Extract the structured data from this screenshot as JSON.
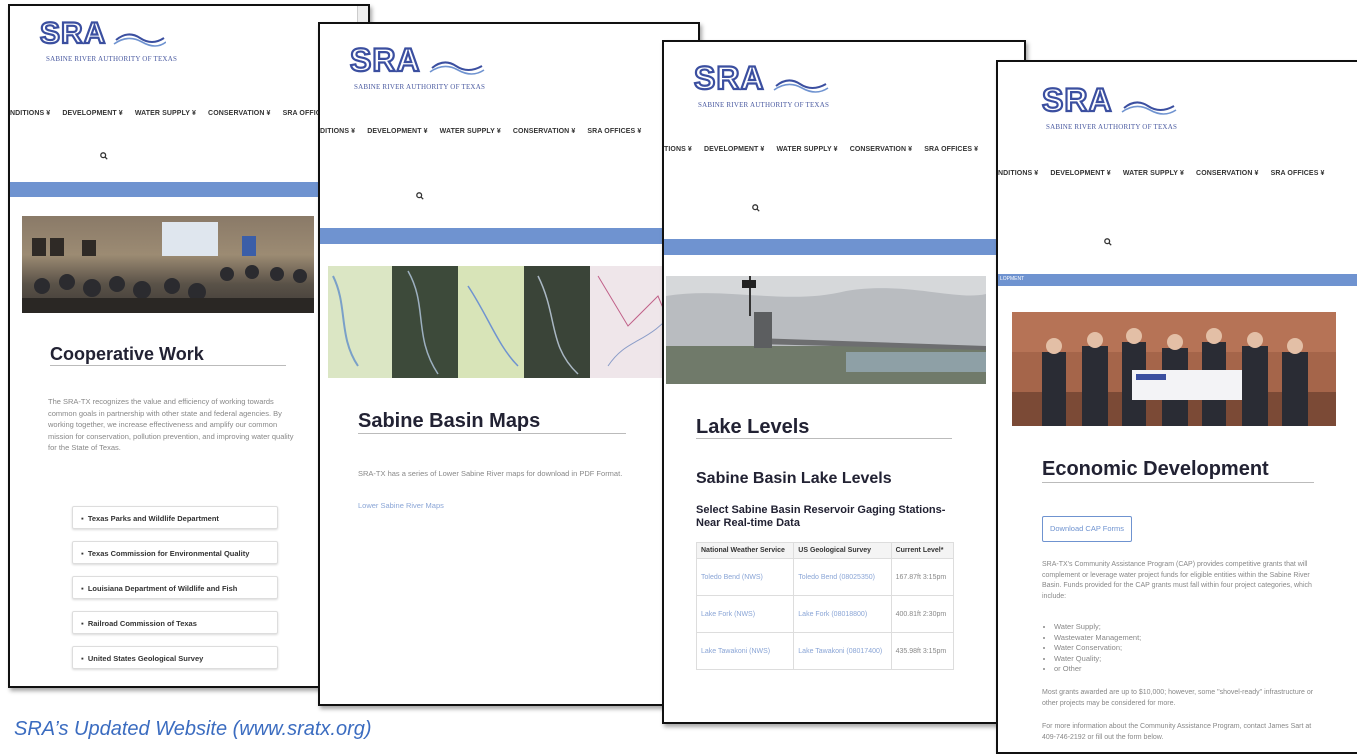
{
  "logo": {
    "mark": "SRA",
    "tagline": "SABINE RIVER AUTHORITY OF TEXAS"
  },
  "nav": {
    "conditions": "NDITIONS ¥",
    "conditions_alt": "DITIONS ¥",
    "conditions_alt2": "TIONS ¥",
    "development": "DEVELOPMENT ¥",
    "water_supply": "WATER SUPPLY ¥",
    "conservation": "CONSERVATION ¥",
    "offices": "SRA OFFICES ¥"
  },
  "panel1": {
    "title": "Cooperative Work",
    "body": "The SRA-TX recognizes the value and efficiency of working towards common goals in partnership with other state and federal agencies.  By working together, we increase effectiveness and amplify our common mission for conservation, pollution prevention, and improving water quality for the State of Texas.",
    "items": [
      "Texas Parks and Wildlife Department",
      "Texas Commission for Environmental Quality",
      "Louisiana Department of Wildlife and Fish",
      "Railroad Commission of Texas",
      "United States Geological Survey"
    ]
  },
  "panel2": {
    "title": "Sabine Basin Maps",
    "body": "SRA-TX has a series of Lower Sabine River maps for download in PDF Format.",
    "link": "Lower Sabine River Maps"
  },
  "panel3": {
    "title": "Lake Levels",
    "subtitle": "Sabine Basin Lake Levels",
    "subhead": "Select Sabine Basin Reservoir Gaging Stations-Near Real-time Data",
    "table": {
      "headers": [
        "National Weather Service",
        "US Geological Survey",
        "Current Level*"
      ],
      "rows": [
        [
          "Toledo Bend (NWS)",
          "Toledo Bend (08025350)",
          "167.87ft 3:15pm"
        ],
        [
          "Lake Fork (NWS)",
          "Lake Fork (08018800)",
          "400.81ft 2:30pm"
        ],
        [
          "Lake Tawakoni (NWS)",
          "Lake Tawakoni (08017400)",
          "435.98ft 3:15pm"
        ]
      ]
    }
  },
  "panel4": {
    "band": "LOPMENT",
    "title": "Economic Development",
    "button": "Download CAP Forms",
    "body": "SRA-TX's Community Assistance Program (CAP) provides competitive grants that will complement or leverage water project funds for eligible entities within the Sabine River Basin. Funds provided for the CAP grants must fall within four project categories, which include:",
    "bullets": [
      "Water Supply;",
      "Wastewater Management;",
      "Water Conservation;",
      "Water Quality;",
      "or Other"
    ],
    "body2": "Most grants awarded are up to $10,000; however, some \"shovel-ready\" infrastructure or other projects may be considered for more.",
    "body3": "For more information about the Community Assistance Program, contact James Sart at 409-746-2192 or fill out the form below."
  },
  "caption": "SRA’s Updated Website (www.sratx.org)",
  "colors": {
    "accent": "#6f93d0",
    "brand": "#3b4fa0",
    "caption": "#3b6cc0"
  }
}
